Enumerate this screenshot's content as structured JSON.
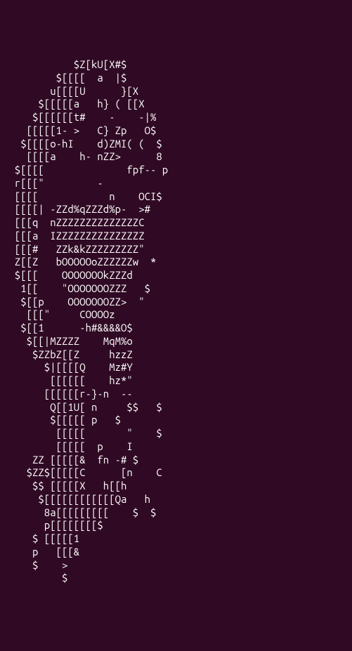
{
  "terminal": {
    "background": "#300a24",
    "foreground": "#ffffff",
    "ascii_lines": [
      "            $Z[kU[X#$",
      "         $[[[[  a  |$",
      "        u[[[[U      }[X",
      "      $[[[[[a   h} ( [[X",
      "     $[[[[[[t#    -    -|%",
      "    [[[[[1- >   C} Zp   O$",
      "   $[[[[o-hI    d)ZMI( (  $",
      "    [[[[a    h- nZZ>      8",
      "  $[[[[              fpf-- p",
      "  r[[[\"         -",
      "  [[[[            n    OCI$",
      "  [[[[| -ZZd%qZZZd%p-  >#",
      "  [[[q  nZZZZZZZZZZZZZZC",
      "  [[[a  IZZZZZZZZZZZZZZZ",
      "  [[[#   ZZk&kZZZZZZZZZ\"",
      "  Z[[Z   bOOOOOoZZZZZZw  *",
      "  $[[[    OOOOOOOkZZZd",
      "   1[[    \"OOOOOOOZZZ   $",
      "   $[[p    OOOOOOOZZ>  \"",
      "    [[[\"     COOOOz",
      "   $[[1      -h#&&&&O$",
      "    $[[|MZZZZ    MqM%o",
      "     $ZZbZ[[Z     hzzZ",
      "       $|[[[[Q    Mz#Y",
      "        [[[[[[    hz*\"",
      "       [[[[[[r-}-n  --",
      "        Q[[1U[ n     $$   $",
      "        $[[[[[ p   $",
      "         [[[[[       \"    $",
      "         [[[[[  p    I",
      "     ZZ [[[[[&  fn -# $",
      "    $ZZ$[[[[[C      [n    C",
      "     $$ [[[[[X   h[[h",
      "      $[[[[[[[[[[[[Qa   h",
      "       8a[[[[[[[[[    $  $",
      "       p[[[[[[[[$",
      "     $ [[[[[1",
      "     p   [[[&",
      "     $    >",
      "          $"
    ]
  }
}
